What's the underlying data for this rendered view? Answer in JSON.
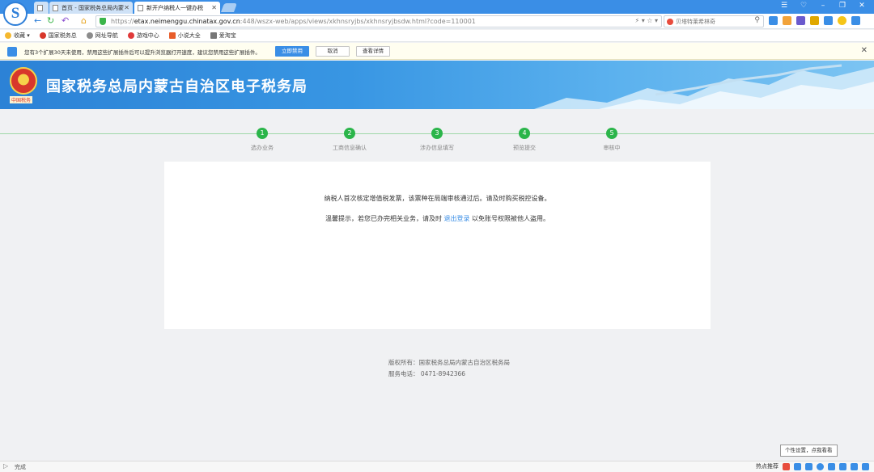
{
  "browser": {
    "tabs": [
      {
        "label": "首页 - 国家税务总局内蒙"
      },
      {
        "label": "新开户纳税人一键办税"
      }
    ],
    "url": {
      "prefix": "https://",
      "host": "etax.neimenggu.chinatax.gov.cn",
      "rest": ":448/wszx-web/apps/views/xkhnsryjbs/xkhnsryjbsdw.html?code=110001"
    },
    "search_placeholder": "贝塔特莱希林奇",
    "bookmarks": [
      {
        "label": "收藏"
      },
      {
        "label": "国家税务总"
      },
      {
        "label": "网址导航"
      },
      {
        "label": "游戏中心"
      },
      {
        "label": "小说大全"
      },
      {
        "label": "爱淘宝"
      }
    ]
  },
  "notice": {
    "text": "您有3个扩展30天未使用，禁用这些扩展插件后可以提升浏览器打开速度，建议您禁用这些扩展插件。",
    "disable_label": "立即禁用",
    "cancel_label": "取消",
    "details_label": "查看详情"
  },
  "site": {
    "title": "国家税务总局内蒙古自治区电子税务局",
    "emblem_caption": "中国税务"
  },
  "steps": [
    {
      "num": "1",
      "label": "选办业务"
    },
    {
      "num": "2",
      "label": "工商信息确认"
    },
    {
      "num": "3",
      "label": "涉办信息填写"
    },
    {
      "num": "4",
      "label": "预览提交"
    },
    {
      "num": "5",
      "label": "审核中"
    }
  ],
  "message": {
    "line1": "纳税人首次核定增值税发票，该票种在局端审核通过后。请及时购买税控设备。",
    "line2_before": "温馨提示，若您已办完相关业务，请及时",
    "logout_link": "退出登录",
    "line2_after": "以免账号权限被他人盗用。"
  },
  "footer": {
    "copyright": "版权所有：国家税务总局内蒙古自治区税务局",
    "phone": "服务电话：  0471-8942366"
  },
  "status": {
    "text": "完成",
    "hot": "热点推荐",
    "tooltip": "个性设置，点我看看"
  }
}
